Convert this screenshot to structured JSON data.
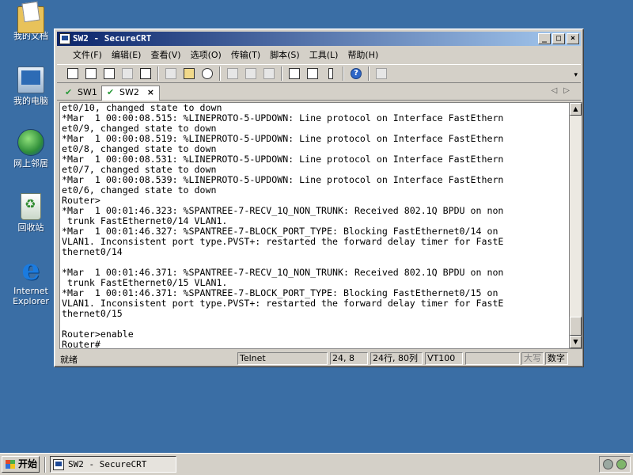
{
  "desktop": {
    "icons": [
      {
        "label": "我的文档"
      },
      {
        "label": "我的电脑"
      },
      {
        "label": "网上邻居"
      },
      {
        "label": "回收站"
      },
      {
        "label": "Internet Explorer"
      }
    ]
  },
  "window": {
    "title": "SW2 - SecureCRT",
    "buttons": {
      "minimize": "_",
      "maximize": "□",
      "close": "×"
    }
  },
  "menu": [
    {
      "label": "文件(F)"
    },
    {
      "label": "编辑(E)"
    },
    {
      "label": "查看(V)"
    },
    {
      "label": "选项(O)"
    },
    {
      "label": "传输(T)"
    },
    {
      "label": "脚本(S)"
    },
    {
      "label": "工具(L)"
    },
    {
      "label": "帮助(H)"
    }
  ],
  "toolbar": {
    "icons": [
      "connect-icon",
      "quick-connect-icon",
      "connect-in-tab-icon",
      "reconnect-icon",
      "disconnect-icon",
      "copy-icon",
      "paste-icon",
      "find-icon",
      "print-icon",
      "print-selection-icon",
      "print-setup-icon",
      "session-options-icon",
      "global-options-icon",
      "keymap-icon",
      "help-icon",
      "sftp-icon"
    ]
  },
  "tabs": [
    {
      "label": "SW1",
      "active": false
    },
    {
      "label": "SW2",
      "active": true,
      "close": "×"
    }
  ],
  "tab_nav": {
    "prev": "◁",
    "next": "▷"
  },
  "terminal": {
    "lines": [
      "et0/10, changed state to down",
      "*Mar  1 00:00:08.515: %LINEPROTO-5-UPDOWN: Line protocol on Interface FastEthern",
      "et0/9, changed state to down",
      "*Mar  1 00:00:08.519: %LINEPROTO-5-UPDOWN: Line protocol on Interface FastEthern",
      "et0/8, changed state to down",
      "*Mar  1 00:00:08.531: %LINEPROTO-5-UPDOWN: Line protocol on Interface FastEthern",
      "et0/7, changed state to down",
      "*Mar  1 00:00:08.539: %LINEPROTO-5-UPDOWN: Line protocol on Interface FastEthern",
      "et0/6, changed state to down",
      "Router>",
      "*Mar  1 00:01:46.323: %SPANTREE-7-RECV_1Q_NON_TRUNK: Received 802.1Q BPDU on non",
      " trunk FastEthernet0/14 VLAN1.",
      "*Mar  1 00:01:46.327: %SPANTREE-7-BLOCK_PORT_TYPE: Blocking FastEthernet0/14 on",
      "VLAN1. Inconsistent port type.PVST+: restarted the forward delay timer for FastE",
      "thernet0/14",
      "",
      "*Mar  1 00:01:46.371: %SPANTREE-7-RECV_1Q_NON_TRUNK: Received 802.1Q BPDU on non",
      " trunk FastEthernet0/15 VLAN1.",
      "*Mar  1 00:01:46.371: %SPANTREE-7-BLOCK_PORT_TYPE: Blocking FastEthernet0/15 on",
      "VLAN1. Inconsistent port type.PVST+: restarted the forward delay timer for FastE",
      "thernet0/15",
      "",
      "Router>enable",
      "Router#"
    ],
    "scroll_position": 1.0
  },
  "status": {
    "ready": "就绪",
    "protocol": "Telnet",
    "cursor": "24,  8",
    "dimensions": "24行, 80列",
    "emulation": "VT100",
    "blank": "",
    "caps": "大写",
    "num": "数字"
  },
  "taskbar": {
    "start": "开始",
    "task": "SW2 - SecureCRT"
  }
}
